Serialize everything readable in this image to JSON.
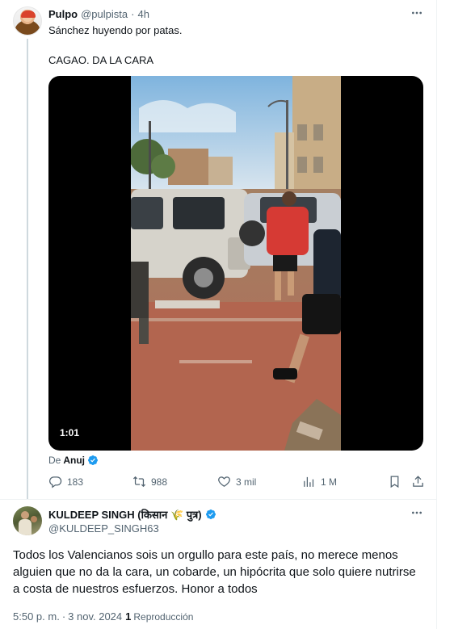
{
  "tweet1": {
    "author_name": "Pulpo",
    "handle": "@pulpista",
    "separator": "·",
    "time": "4h",
    "more_icon": "more-horizontal-icon",
    "text_line1": "Sánchez huyendo por patas.",
    "text_line2": "CAGAO. DA LA CARA",
    "video": {
      "duration": "1:01",
      "from_prefix": "De",
      "from_author": "Anuj"
    },
    "actions": {
      "replies": "183",
      "reposts": "988",
      "likes": "3 mil",
      "views": "1 M"
    }
  },
  "tweet2": {
    "author_name": "KULDEEP SINGH (किसान 🌾 पुत्र)",
    "handle": "@KULDEEP_SINGH63",
    "more_icon": "more-horizontal-icon",
    "text": "Todos los Valencianos sois un orgullo para este país, no merece menos alguien que no da la cara, un cobarde, un hipócrita que solo quiere nutrirse a costa de nuestros esfuerzos. Honor a todos",
    "time": "5:50 p. m.",
    "separator": "·",
    "date": "3 nov. 2024",
    "repost_count": "1",
    "repost_label": "Reproducción"
  },
  "colors": {
    "text_primary": "#0f1419",
    "text_secondary": "#536471",
    "verified_blue": "#1d9bf0",
    "border": "#eff3f4"
  }
}
